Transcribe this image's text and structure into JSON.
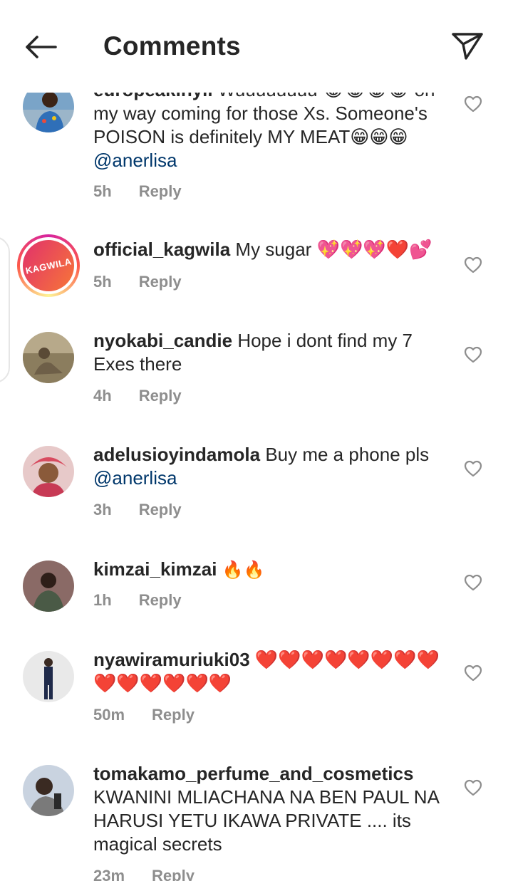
{
  "header": {
    "title": "Comments",
    "back_icon": "arrow-left-icon",
    "share_icon": "paper-plane-icon"
  },
  "comments": [
    {
      "username": "europeakinyii",
      "text_pre": "Wuuuuuuuu 😂😂😂😂 on my way coming for those Xs. Someone's POISON is definitely MY MEAT😁😁😁 ",
      "mention": "@anerlisa",
      "time": "5h",
      "reply": "Reply"
    },
    {
      "username": "official_kagwila",
      "text_pre": "My sugar 💖💖💖❤️💕",
      "mention": "",
      "time": "5h",
      "reply": "Reply",
      "avatar_text": "KAGWILA"
    },
    {
      "username": "nyokabi_candie",
      "text_pre": "Hope i dont find my 7 Exes there",
      "mention": "",
      "time": "4h",
      "reply": "Reply"
    },
    {
      "username": "adelusioyindamola",
      "text_pre": "Buy me a phone pls ",
      "mention": "@anerlisa",
      "time": "3h",
      "reply": "Reply"
    },
    {
      "username": "kimzai_kimzai",
      "text_pre": "🔥🔥",
      "mention": "",
      "time": "1h",
      "reply": "Reply"
    },
    {
      "username": "nyawiramuriuki03",
      "text_pre": "❤️❤️❤️❤️❤️❤️❤️❤️❤️❤️❤️❤️❤️❤️",
      "mention": "",
      "time": "50m",
      "reply": "Reply"
    },
    {
      "username": "tomakamo_perfume_and_cosmetics",
      "text_pre": "KWANINI MLIACHANA NA BEN PAUL NA HARUSI YETU IKAWA PRIVATE .... its magical secrets",
      "mention": "",
      "time": "23m",
      "reply": "Reply"
    }
  ],
  "colors": {
    "text": "#262626",
    "muted": "#8e8e8e",
    "mention": "#00376b",
    "story_ring": "#d6249f"
  }
}
